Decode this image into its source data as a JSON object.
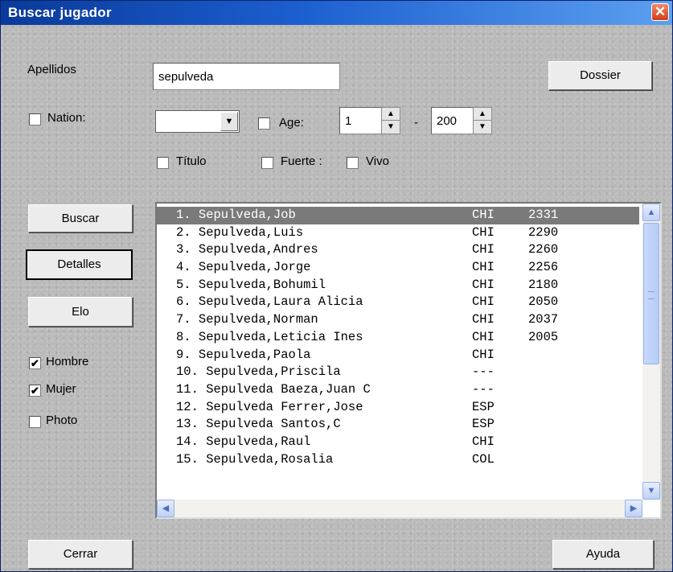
{
  "window": {
    "title": "Buscar jugador",
    "close_glyph": "✕"
  },
  "form": {
    "apellidos_label": "Apellidos",
    "apellidos_value": "sepulveda",
    "dossier_label": "Dossier",
    "nation_label": "Nation:",
    "nation_checked": false,
    "nation_value": "",
    "age_label": "Age:",
    "age_checked": false,
    "age_min": "1",
    "age_separator": "-",
    "age_max": "200",
    "titulo_label": "Título",
    "fuerte_label": "Fuerte :",
    "vivo_label": "Vivo"
  },
  "side_buttons": {
    "buscar": "Buscar",
    "detalles": "Detalles",
    "elo": "Elo"
  },
  "filters": [
    {
      "label": "Hombre",
      "checked": true
    },
    {
      "label": "Mujer",
      "checked": true
    },
    {
      "label": "Photo",
      "checked": false
    }
  ],
  "results": {
    "selected_index": 0,
    "rows": [
      {
        "name": "1. Sepulveda,Job",
        "fed": "CHI",
        "elo": "2331"
      },
      {
        "name": "2. Sepulveda,Luis",
        "fed": "CHI",
        "elo": "2290"
      },
      {
        "name": "3. Sepulveda,Andres",
        "fed": "CHI",
        "elo": "2260"
      },
      {
        "name": "4. Sepulveda,Jorge",
        "fed": "CHI",
        "elo": "2256"
      },
      {
        "name": "5. Sepulveda,Bohumil",
        "fed": "CHI",
        "elo": "2180"
      },
      {
        "name": "6. Sepulveda,Laura Alicia",
        "fed": "CHI",
        "elo": "2050"
      },
      {
        "name": "7. Sepulveda,Norman",
        "fed": "CHI",
        "elo": "2037"
      },
      {
        "name": "8. Sepulveda,Leticia Ines",
        "fed": "CHI",
        "elo": "2005"
      },
      {
        "name": "9. Sepulveda,Paola",
        "fed": "CHI",
        "elo": ""
      },
      {
        "name": "10. Sepulveda,Priscila",
        "fed": "---",
        "elo": ""
      },
      {
        "name": "11. Sepulveda Baeza,Juan C",
        "fed": "---",
        "elo": ""
      },
      {
        "name": "12. Sepulveda Ferrer,Jose",
        "fed": "ESP",
        "elo": ""
      },
      {
        "name": "13. Sepulveda Santos,C",
        "fed": "ESP",
        "elo": ""
      },
      {
        "name": "14. Sepulveda,Raul",
        "fed": "CHI",
        "elo": ""
      },
      {
        "name": "15. Sepulveda,Rosalia",
        "fed": "COL",
        "elo": ""
      }
    ]
  },
  "footer": {
    "cerrar": "Cerrar",
    "ayuda": "Ayuda"
  },
  "icons": {
    "dropdown": "▼",
    "spin_up": "▲",
    "spin_down": "▼",
    "check": "✔",
    "scroll_up": "▲",
    "scroll_down": "▼",
    "scroll_left": "◀",
    "scroll_right": "▶"
  },
  "colors": {
    "title_bar": "#1c5fd0",
    "selection": "#7a7a7a",
    "close": "#d23c1a"
  }
}
